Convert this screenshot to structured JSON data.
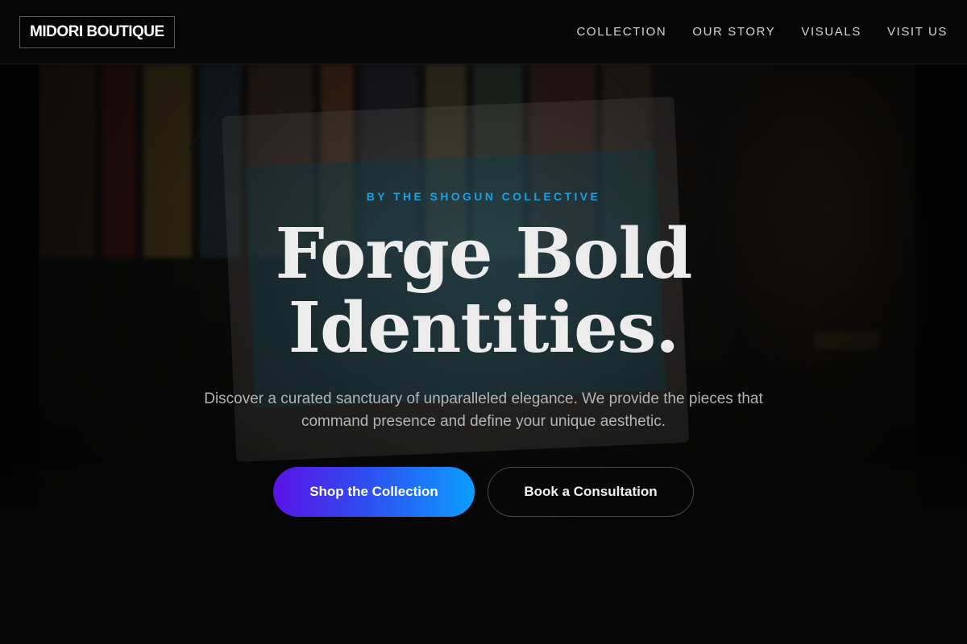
{
  "header": {
    "logo": "MIDORI BOUTIQUE",
    "nav": [
      {
        "label": "COLLECTION"
      },
      {
        "label": "OUR STORY"
      },
      {
        "label": "VISUALS"
      },
      {
        "label": "VISIT US"
      }
    ]
  },
  "hero": {
    "eyebrow": "BY THE SHOGUN COLLECTIVE",
    "headline_line1": "Forge Bold",
    "headline_line2": "Identities.",
    "subtext": "Discover a curated sanctuary of unparalleled elegance. We provide the pieces that command presence and define your unique aesthetic.",
    "primary_cta": "Shop the Collection",
    "secondary_cta": "Book a Consultation"
  },
  "background": {
    "image_subject": "shop-window-open-sign-photo"
  },
  "colors": {
    "eyebrow_accent": "#1f9ee0",
    "cta_gradient_start": "#5b12e6",
    "cta_gradient_end": "#0c9dff",
    "page_background": "#080808"
  }
}
